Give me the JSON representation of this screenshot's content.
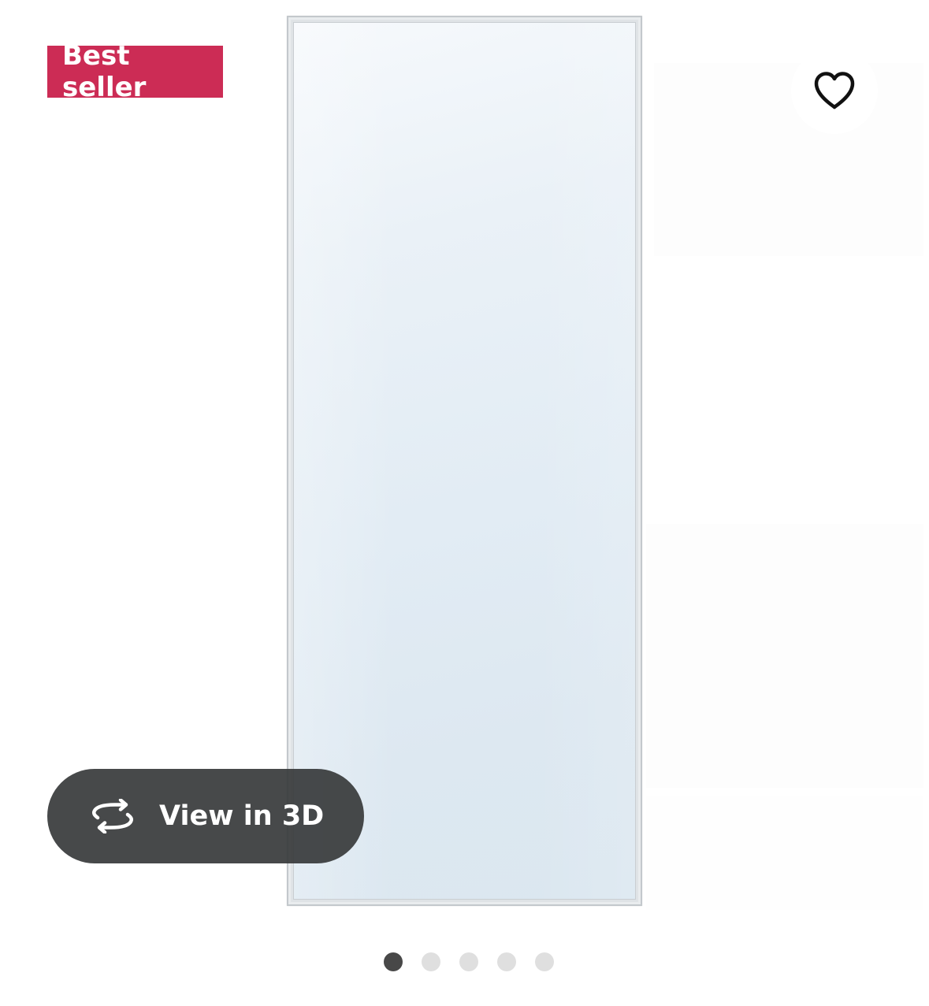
{
  "badge": {
    "label": "Best seller",
    "color": "#cc2c55"
  },
  "favorite": {
    "icon": "heart-outline-icon",
    "selected": false
  },
  "product_image": {
    "subject": "mirror"
  },
  "view_3d": {
    "label": "View in 3D",
    "icon": "rotate-arrows-icon"
  },
  "carousel": {
    "total": 5,
    "active_index": 0
  }
}
